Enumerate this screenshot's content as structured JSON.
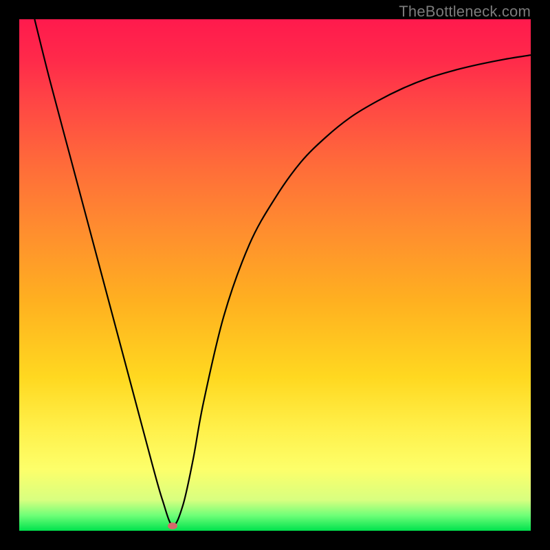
{
  "watermark": "TheBottleneck.com",
  "chart_data": {
    "type": "line",
    "title": "",
    "xlabel": "",
    "ylabel": "",
    "xlim": [
      0,
      100
    ],
    "ylim": [
      0,
      100
    ],
    "series": [
      {
        "name": "curve",
        "x": [
          3,
          6,
          10,
          14,
          18,
          22,
          26,
          28,
          30,
          32,
          34,
          36,
          40,
          45,
          50,
          55,
          60,
          65,
          70,
          75,
          80,
          85,
          90,
          95,
          100
        ],
        "y": [
          100,
          88,
          73,
          58,
          43,
          28,
          13,
          6,
          1,
          5,
          14,
          25,
          42,
          56,
          65,
          72,
          77,
          81,
          84,
          86.5,
          88.5,
          90,
          91.2,
          92.2,
          93
        ]
      }
    ],
    "markers": [
      {
        "name": "min-point",
        "x": 30,
        "y": 1
      }
    ]
  }
}
